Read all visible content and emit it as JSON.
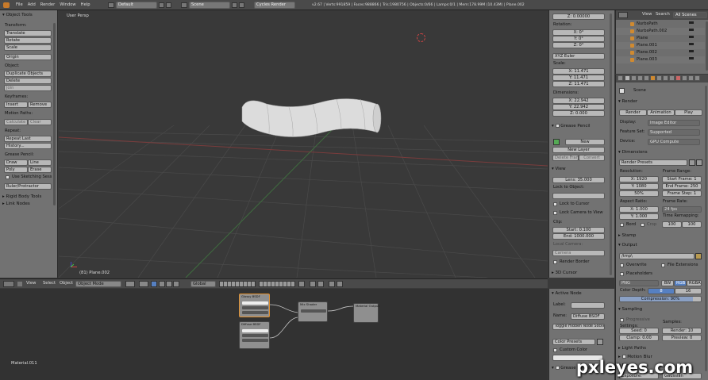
{
  "topbar": {
    "menus": [
      "File",
      "Add",
      "Render",
      "Window",
      "Help"
    ],
    "layout": "Default",
    "scene": "Scene",
    "engine": "Cycles Render",
    "stats": "v2.67 | Verts:991859 | Faces:988866 | Tris:1980756 | Objects:0/66 | Lamps:0/1 | Mem:178.99M (10.43M) | Plane.002"
  },
  "toolshelf": {
    "title": "Object Tools",
    "transform_label": "Transform:",
    "translate": "Translate",
    "rotate": "Rotate",
    "scale": "Scale",
    "origin": "Origin",
    "object_label": "Object:",
    "duplicate": "Duplicate Objects",
    "delete": "Delete",
    "join": "Join",
    "keyframes_label": "Keyframes:",
    "insert": "Insert",
    "remove": "Remove",
    "motion_label": "Motion Paths:",
    "calculate": "Calculate",
    "clear": "Clear",
    "repeat_label": "Repeat:",
    "repeat_last": "Repeat Last",
    "history": "History...",
    "grease_label": "Grease Pencil:",
    "draw": "Draw",
    "line": "Line",
    "poly": "Poly",
    "erase": "Erase",
    "use_sketching": "Use Sketching Sess",
    "ruler": "Ruler/Protractor",
    "rigid": "Rigid Body Tools",
    "link_nodes": "Link Nodes"
  },
  "viewport": {
    "label": "User Persp",
    "object_label": "(81) Plane.002"
  },
  "vp_header": {
    "view": "View",
    "select": "Select",
    "object": "Object",
    "mode": "Object Mode",
    "pivot": "Global"
  },
  "node_editor": {
    "material": "Material.011",
    "nodes": [
      {
        "title": "Glossy BSDF"
      },
      {
        "title": "Diffuse BSDF"
      },
      {
        "title": "Mix Shader"
      },
      {
        "title": "Material Output"
      }
    ]
  },
  "npanel": {
    "z_loc": "Z: 0.00000",
    "rotation_label": "Rotation:",
    "rx": "X: 0°",
    "ry": "Y: 0°",
    "rz": "Z: 0°",
    "rot_mode": "XYZ Euler",
    "scale_label": "Scale:",
    "sx": "X: 11.471",
    "sy": "Y: 11.471",
    "sz": "Z: 11.471",
    "dim_label": "Dimensions:",
    "dx": "X: 22.942",
    "dy": "Y: 22.942",
    "dz": "Z: 0.000",
    "grease": "Grease Pencil",
    "new": "New",
    "new_layer": "New Layer",
    "delete_frame": "Delete Frame",
    "convert": "Convert",
    "view_label": "View",
    "lens": "Lens: 35.000",
    "lock_object": "Lock to Object:",
    "lock_cursor": "Lock to Cursor",
    "lock_camera": "Lock Camera to View",
    "clip_label": "Clip:",
    "start": "Start: 0.100",
    "end": "End: 1000.000",
    "local_camera": "Local Camera:",
    "camera": "Camera",
    "render_border": "Render Border",
    "cursor_3d": "3D Cursor"
  },
  "node_npanel": {
    "active_node": "Active Node",
    "label": "Label:",
    "name_label": "Name:",
    "name": "Diffuse BSDF",
    "toggle_hidden": "Toggle Hidden Node Sockets",
    "color_presets": "Color Presets",
    "custom_color": "Custom Color",
    "grease": "Grease Pencil"
  },
  "outliner": {
    "view": "View",
    "search": "Search",
    "scope": "All Scenes",
    "items": [
      "NurbsPath",
      "NurbsPath.002",
      "Plane",
      "Plane.001",
      "Plane.002",
      "Plane.003"
    ]
  },
  "properties": {
    "scene": "Scene",
    "render": "Render",
    "render_btn": "Render",
    "animation_btn": "Animation",
    "play_btn": "Play",
    "display_label": "Display:",
    "display_val": "Image Editor",
    "feature_label": "Feature Set:",
    "feature_val": "Supported",
    "device_label": "Device:",
    "device_val": "GPU Compute",
    "dimensions": "Dimensions",
    "render_presets": "Render Presets",
    "resolution_label": "Resolution:",
    "res_x": "X: 1920",
    "res_y": "Y: 1080",
    "res_pct": "50%",
    "frame_range_label": "Frame Range:",
    "start_frame": "Start Frame: 1",
    "end_frame": "End Frame: 250",
    "frame_step": "Frame Step: 1",
    "aspect_label": "Aspect Ratio:",
    "asp_x": "X: 1.000",
    "asp_y": "Y: 1.000",
    "frame_rate_label": "Frame Rate:",
    "fps": "24 fps",
    "time_remap": "Time Remapping:",
    "remap_old": "100",
    "remap_new": "100",
    "border": "Bord",
    "crop": "Crop",
    "stamp": "Stamp",
    "output": "Output",
    "output_path": "/tmp\\",
    "overwrite": "Overwrite",
    "file_ext": "File Extensions",
    "placeholders": "Placeholders",
    "format": "PNG",
    "bw": "BW",
    "rgb": "RGB",
    "rgba": "RGBA",
    "color_depth_label": "Color Depth:",
    "depth_8": "8",
    "depth_16": "16",
    "compression": "Compression: 90%",
    "sampling": "Sampling",
    "progressive": "Progressive",
    "settings_label": "Settings:",
    "seed": "Seed: 0",
    "clamp": "Clamp: 0.00",
    "samples_label": "Samples:",
    "render_samples": "Render: 10",
    "preview_samples": "Preview: 0",
    "light_paths": "Light Paths",
    "motion_blur": "Motion Blur",
    "film": "Film",
    "exposure": "Exposure:",
    "filter": "Gaussian"
  },
  "watermark": "pxleyes.com"
}
